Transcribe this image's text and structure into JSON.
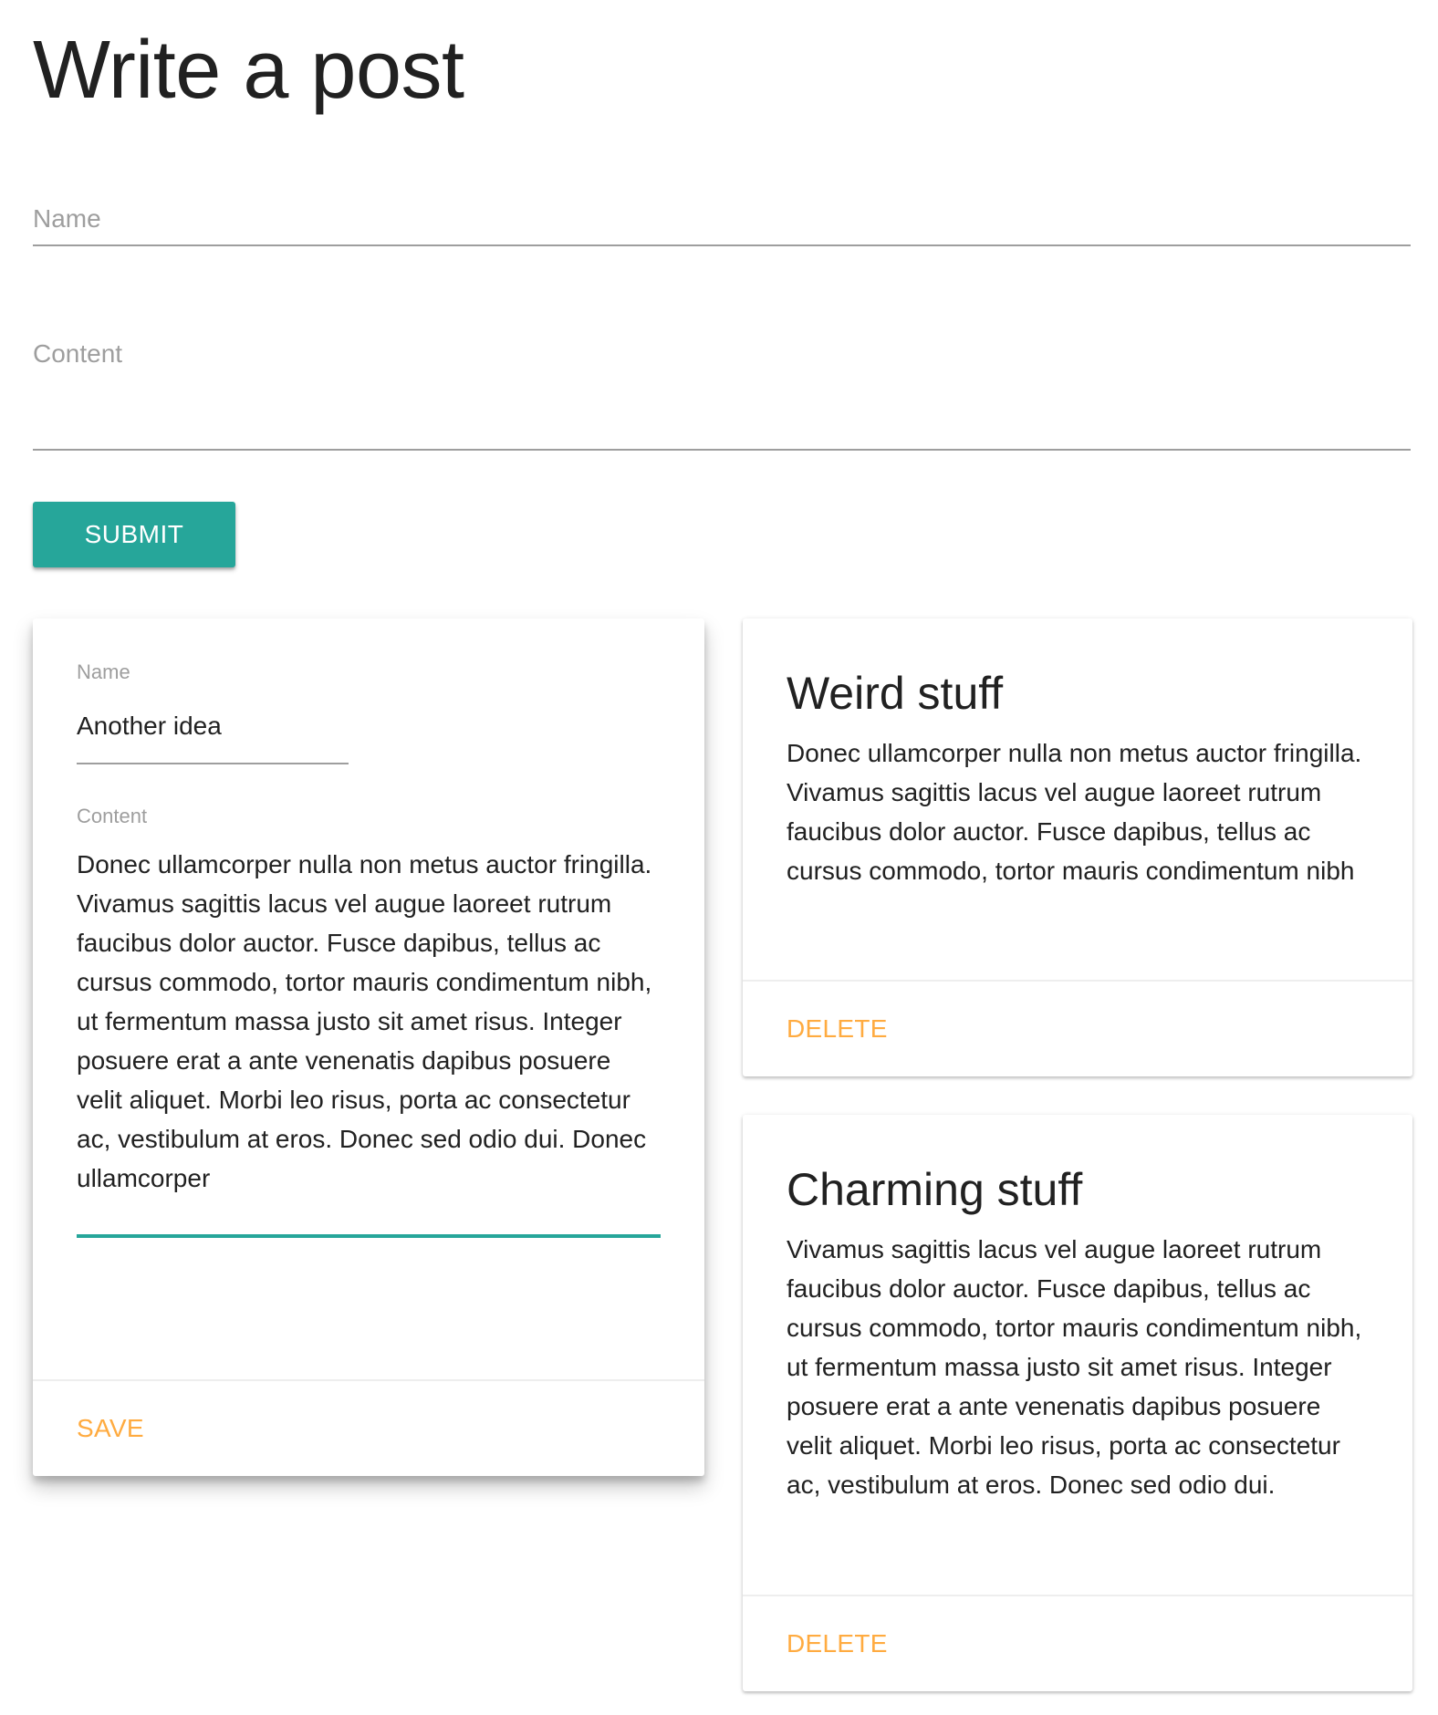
{
  "page": {
    "title": "Write a post"
  },
  "form": {
    "name_placeholder": "Name",
    "content_placeholder": "Content",
    "submit_label": "SUBMIT"
  },
  "edit_card": {
    "name_label": "Name",
    "name_value": "Another idea",
    "content_label": "Content",
    "content_value": "Donec ullamcorper nulla non metus auctor fringilla. Vivamus sagittis lacus vel augue laoreet rutrum faucibus dolor auctor. Fusce dapibus, tellus ac cursus commodo, tortor mauris condimentum nibh, ut fermentum massa justo sit amet risus. Integer posuere erat a ante venenatis dapibus posuere velit aliquet. Morbi leo risus, porta ac consectetur ac, vestibulum at eros. Donec sed odio dui. Donec ullamcorper",
    "save_label": "SAVE"
  },
  "posts": [
    {
      "title": "Weird stuff",
      "content": "Donec ullamcorper nulla non metus auctor fringilla. Vivamus sagittis lacus vel augue laoreet rutrum faucibus dolor auctor. Fusce dapibus, tellus ac cursus commodo, tortor mauris condimentum nibh",
      "delete_label": "DELETE"
    },
    {
      "title": "Charming stuff",
      "content": "Vivamus sagittis lacus vel augue laoreet rutrum faucibus dolor auctor. Fusce dapibus, tellus ac cursus commodo, tortor mauris condimentum nibh, ut fermentum massa justo sit amet risus. Integer posuere erat a ante venenatis dapibus posuere velit aliquet. Morbi leo risus, porta ac consectetur ac, vestibulum at eros. Donec sed odio dui.",
      "delete_label": "DELETE"
    }
  ],
  "colors": {
    "accent": "#26a69a",
    "action": "#ffab40",
    "text": "#212121",
    "muted": "#9e9e9e"
  }
}
